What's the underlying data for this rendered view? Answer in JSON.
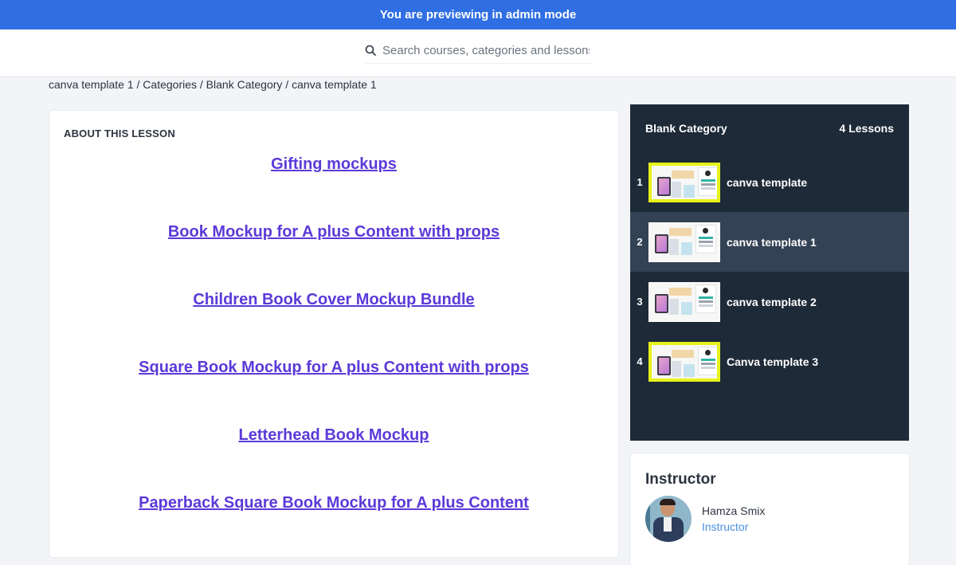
{
  "admin_bar": {
    "text": "You are previewing in admin mode"
  },
  "search": {
    "placeholder": "Search courses, categories and lessons"
  },
  "breadcrumb": {
    "items": [
      "canva template 1",
      "Categories",
      "Blank Category",
      "canva template 1"
    ],
    "separator": "/"
  },
  "lesson": {
    "about_heading": "ABOUT THIS LESSON",
    "links": [
      "Gifting mockups",
      "Book Mockup for A plus Content with props",
      "Children Book Cover Mockup Bundle",
      "Square Book Mockup for A plus Content with props",
      "Letterhead Book Mockup",
      "Paperback Square Book Mockup for A plus Content"
    ]
  },
  "sidebar": {
    "category": "Blank Category",
    "lesson_count": "4 Lessons",
    "lessons": [
      {
        "number": "1",
        "title": "canva template",
        "thumb_border": "yellow",
        "active": false
      },
      {
        "number": "2",
        "title": "canva template 1",
        "thumb_border": "white",
        "active": true
      },
      {
        "number": "3",
        "title": "canva template 2",
        "thumb_border": "white",
        "active": false
      },
      {
        "number": "4",
        "title": "Canva template 3",
        "thumb_border": "yellow",
        "active": false
      }
    ]
  },
  "instructor": {
    "heading": "Instructor",
    "name": "Hamza Smix",
    "role": "Instructor"
  },
  "colors": {
    "admin_bar": "#2f6fe3",
    "link": "#5b3ad8",
    "sidebar_bg": "#1e2a38",
    "active_lesson": "#334254",
    "thumb_highlight": "#e6f21a"
  },
  "icons": {
    "search": "search-icon"
  }
}
